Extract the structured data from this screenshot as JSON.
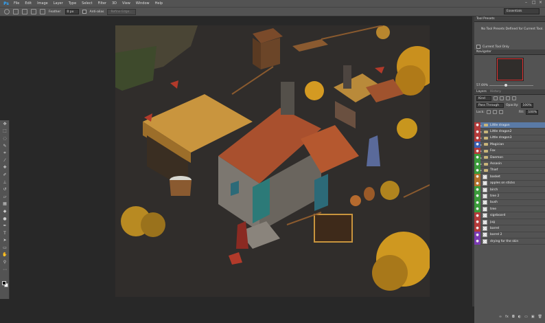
{
  "menubar": {
    "logo": "Ps",
    "items": [
      "File",
      "Edit",
      "Image",
      "Layer",
      "Type",
      "Select",
      "Filter",
      "3D",
      "View",
      "Window",
      "Help"
    ]
  },
  "options": {
    "feather_label": "Feather:",
    "feather_value": "0 px",
    "antialias_label": "Anti-alias",
    "refine_label": "Refine Edge...",
    "workspace": "Essentials"
  },
  "tool_presets": {
    "tab": "Tool Presets",
    "message": "No Tool Presets Defined for Current Tool.",
    "current_tool_only": "Current Tool Only"
  },
  "navigator": {
    "tab": "Navigator",
    "zoom": "57.69%"
  },
  "layers": {
    "tabs": [
      "Layers",
      "History"
    ],
    "kind": "Kind",
    "blend_mode": "Pass Through",
    "opacity_label": "Opacity:",
    "opacity": "100%",
    "lock_label": "Lock:",
    "fill_label": "Fill:",
    "fill": "100%",
    "items": [
      {
        "name": "Little dragon",
        "folder": true,
        "color": "#b23a3a",
        "selected": true
      },
      {
        "name": "Little dragon2",
        "folder": true,
        "color": "#b23a3a"
      },
      {
        "name": "Little dragon3",
        "folder": true,
        "color": "#b23a3a"
      },
      {
        "name": "Magician",
        "folder": true,
        "color": "#3a5fb2"
      },
      {
        "name": "Fox",
        "folder": true,
        "color": "#b23a3a"
      },
      {
        "name": "Daemon",
        "folder": true,
        "color": "#3a9a3a"
      },
      {
        "name": "Assasin",
        "folder": true,
        "color": "#3a9a3a"
      },
      {
        "name": "Thief",
        "folder": true,
        "color": "#3a9a3a"
      },
      {
        "name": "basket",
        "folder": false,
        "color": "#b2702a"
      },
      {
        "name": "apples on sticks",
        "folder": false,
        "color": "#b2702a"
      },
      {
        "name": "birch",
        "folder": false,
        "color": "#3a9a3a"
      },
      {
        "name": "tree 2",
        "folder": false,
        "color": "#3a9a3a"
      },
      {
        "name": "bush",
        "folder": false,
        "color": "#3a9a3a"
      },
      {
        "name": "tree",
        "folder": false,
        "color": "#3a9a3a"
      },
      {
        "name": "signboard",
        "folder": false,
        "color": "#b23a3a"
      },
      {
        "name": "jug",
        "folder": false,
        "color": "#b23a3a"
      },
      {
        "name": "barrel",
        "folder": false,
        "color": "#b23a3a"
      },
      {
        "name": "barrel 2",
        "folder": false,
        "color": "#7a3ab2"
      },
      {
        "name": "drying for the skin",
        "folder": false,
        "color": "#7a3ab2"
      }
    ]
  }
}
